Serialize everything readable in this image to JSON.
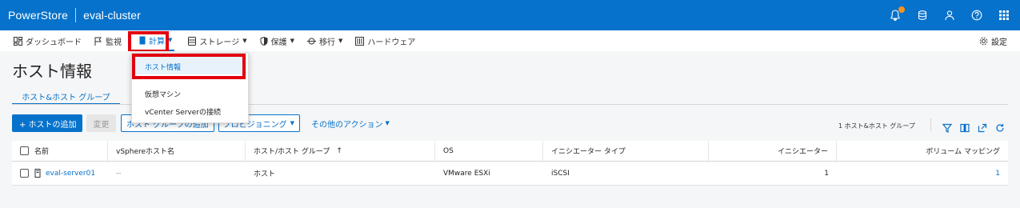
{
  "topbar": {
    "brand": "PowerStore",
    "cluster": "eval-cluster",
    "icons": [
      "bell-icon",
      "jobs-icon",
      "user-icon",
      "help-icon",
      "apps-grid-icon"
    ]
  },
  "nav": {
    "items": [
      {
        "label": "ダッシュボード",
        "icon": "dashboard-icon"
      },
      {
        "label": "監視",
        "icon": "flag-icon"
      },
      {
        "label": "計算",
        "icon": "compute-icon"
      },
      {
        "label": "ストレージ",
        "icon": "storage-icon"
      },
      {
        "label": "保護",
        "icon": "shield-icon"
      },
      {
        "label": "移行",
        "icon": "migrate-icon"
      },
      {
        "label": "ハードウェア",
        "icon": "hardware-icon"
      }
    ],
    "settings": "設定"
  },
  "page": {
    "title": "ホスト情報",
    "tab": "ホスト&ホスト グループ"
  },
  "toolbar": {
    "add_host": "+ ホストの追加",
    "modify": "変更",
    "add_group": "ホスト グループの追加",
    "provisioning": "プロビジョニング",
    "more_actions": "その他のアクション",
    "count": "1 ホスト&ホスト グループ"
  },
  "table": {
    "headers": [
      "名前",
      "vSphereホスト名",
      "ホスト/ホスト グループ",
      "OS",
      "イニシエーター タイプ",
      "イニシエーター",
      "ボリューム マッピング"
    ],
    "sort_indicator": "↑",
    "rows": [
      {
        "name": "eval-server01",
        "vsphere": "--",
        "type": "ホスト",
        "os": "VMware ESXi",
        "initiator_type": "iSCSI",
        "initiators": "1",
        "volume_mappings": "1"
      }
    ]
  },
  "dropdown": {
    "items": [
      "ホスト情報",
      "仮想マシン",
      "vCenter Serverの接続"
    ]
  },
  "colors": {
    "brand_blue": "#0672cb",
    "highlight_red": "#e2000f",
    "notification_orange": "#f7941d"
  }
}
